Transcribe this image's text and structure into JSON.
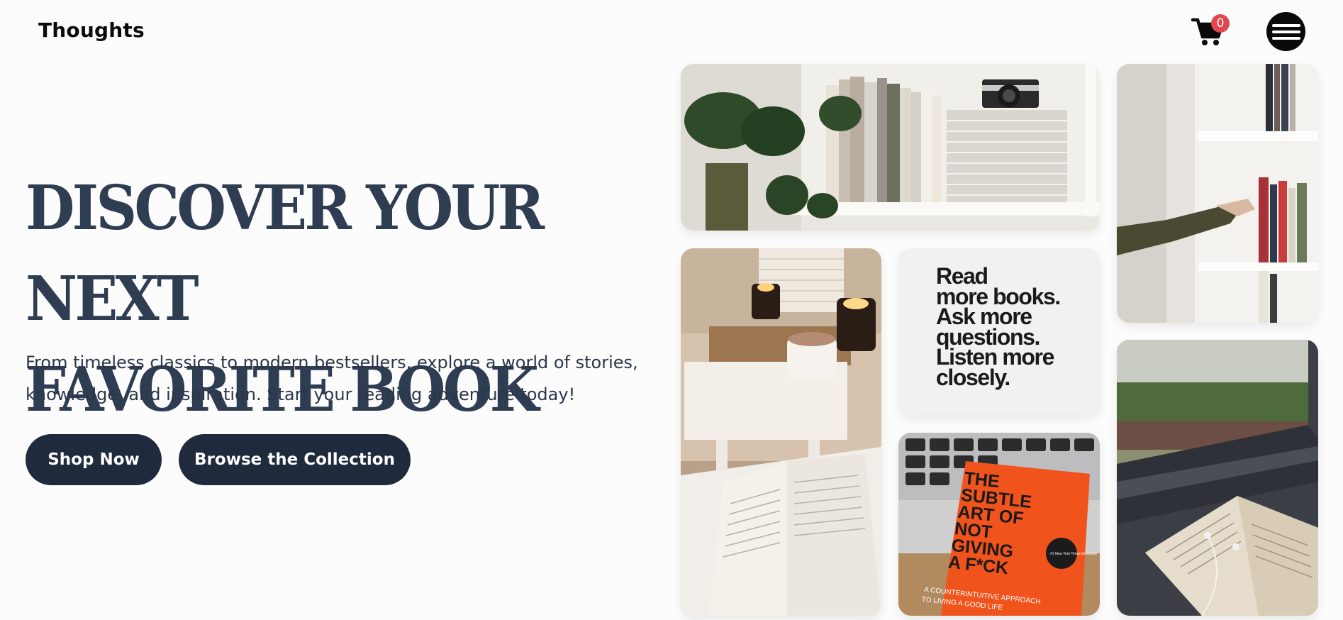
{
  "header": {
    "brand": "Thoughts",
    "cart_icon": "shopping-cart-icon",
    "cart_count": "0",
    "menu_icon": "hamburger-menu-icon"
  },
  "hero": {
    "title_line1": "DISCOVER YOUR NEXT",
    "title_line2": "FAVORITE BOOK",
    "subtitle_line1": "From timeless classics to modern bestsellers, explore a world of stories,",
    "subtitle_line2": "knowledge, and inspiration. Start your reading adventure today!",
    "shop_button": "Shop Now",
    "browse_button": "Browse the Collection"
  },
  "gallery": {
    "quote_lines": [
      "Read",
      "more books.",
      "Ask more",
      "questions.",
      "Listen more",
      "closely."
    ],
    "cover_title_lines": [
      "THE",
      "SUBTLE",
      "ART OF",
      "NOT",
      "GIVING",
      "A F*CK"
    ],
    "cover_subtitle_lines": [
      "A COUNTERINTUITIVE APPROACH",
      "TO LIVING A GOOD LIFE"
    ],
    "cover_badge": "#1 New York Times Bestseller"
  },
  "colors": {
    "heading": "#2f3d52",
    "button_bg": "#1f2a3c",
    "badge": "#e0474c",
    "book_orange": "#f0541c"
  }
}
